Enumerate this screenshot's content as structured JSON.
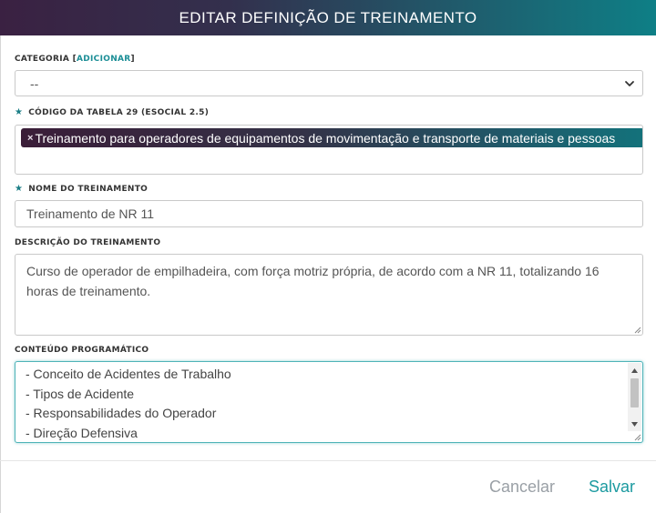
{
  "modal": {
    "title": "EDITAR DEFINIÇÃO DE TREINAMENTO"
  },
  "categoria": {
    "label": "CATEGORIA [",
    "add_link": "ADICIONAR",
    "label_end": "]",
    "selected": "--"
  },
  "codigo": {
    "label": "CÓDIGO DA TABELA 29 (ESOCIAL 2.5)",
    "required_icon": "star-icon",
    "tag_remove": "×",
    "tag": "Treinamento para operadores de equipamentos de movimentação e transporte de materiais e pessoas"
  },
  "nome": {
    "label": "NOME DO TREINAMENTO",
    "required_icon": "star-icon",
    "value": "Treinamento de NR 11"
  },
  "descricao": {
    "label": "DESCRIÇÃO DO TREINAMENTO",
    "value": "Curso de operador de empilhadeira, com força motriz própria, de acordo com a NR 11, totalizando 16 horas de treinamento."
  },
  "conteudo": {
    "label": "CONTEÚDO PROGRAMÁTICO",
    "lines": [
      "- Conceito de Acidentes de Trabalho",
      "- Tipos de Acidente",
      "- Responsabilidades do Operador",
      "- Direção Defensiva"
    ]
  },
  "footer": {
    "cancel": "Cancelar",
    "save": "Salvar"
  },
  "colors": {
    "accent": "#1b9aa0",
    "header_start": "#3a2142",
    "header_end": "#0e7f86"
  }
}
